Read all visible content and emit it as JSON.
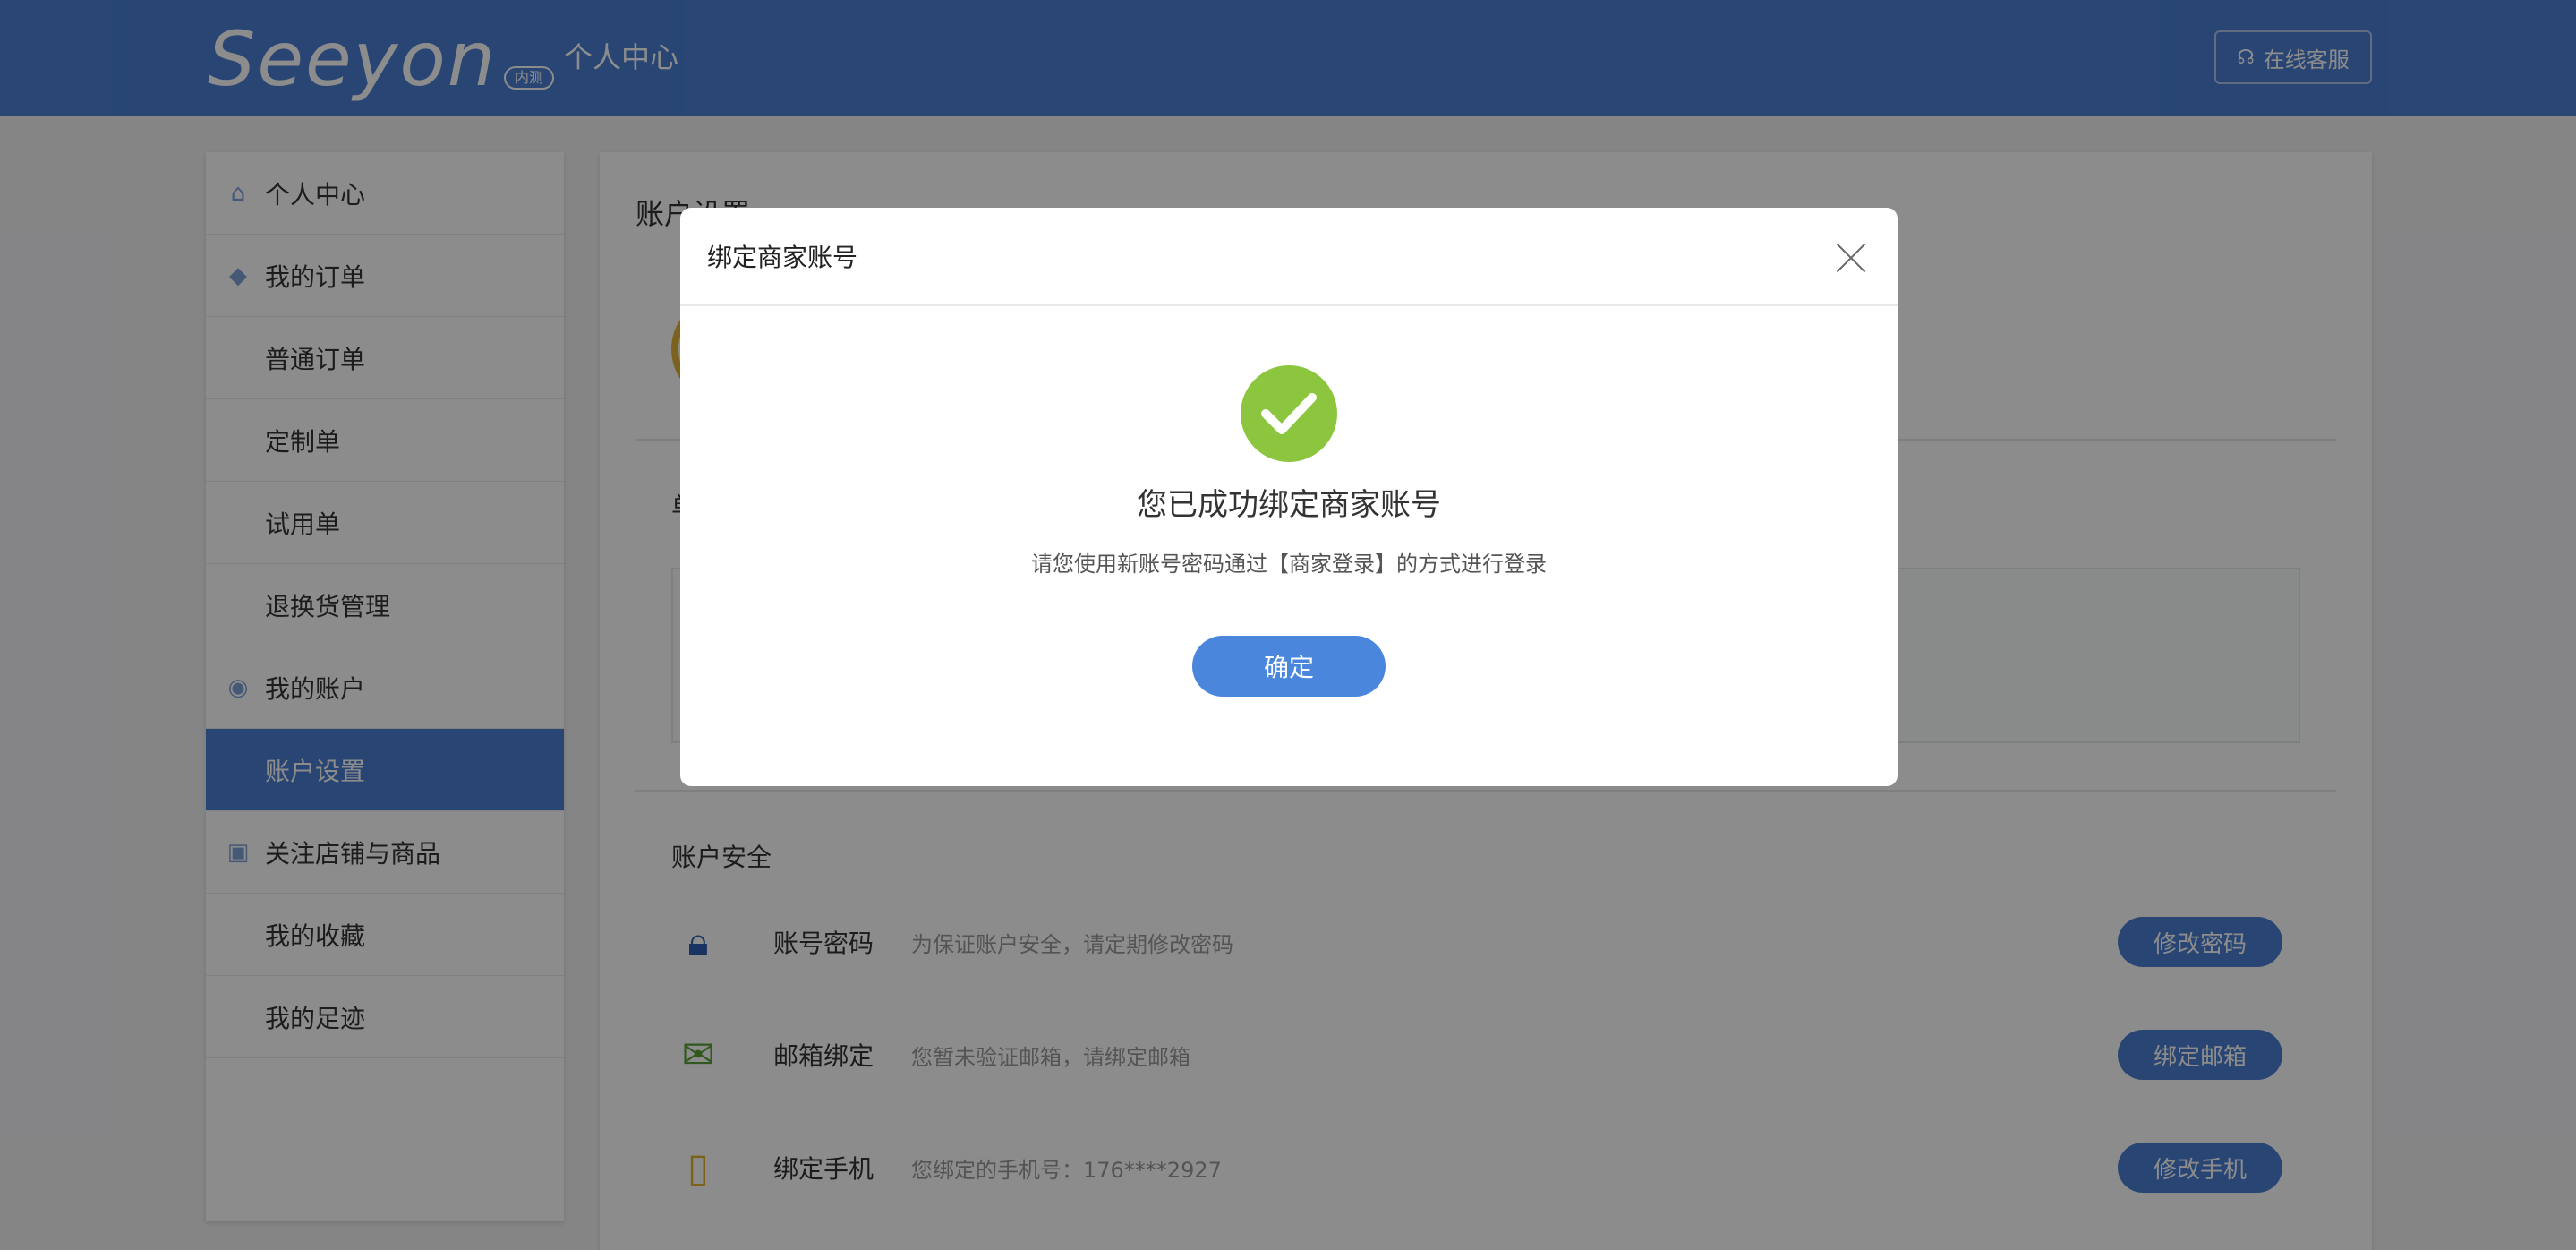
{
  "header": {
    "logo_text": "Seeyon",
    "logo_badge": "内测",
    "title": "个人中心",
    "service_label": "在线客服"
  },
  "sidebar": {
    "items": [
      {
        "label": "个人中心",
        "icon": "home-icon",
        "type": "group"
      },
      {
        "label": "我的订单",
        "icon": "box-icon",
        "type": "group"
      },
      {
        "label": "普通订单",
        "type": "child"
      },
      {
        "label": "定制单",
        "type": "child"
      },
      {
        "label": "试用单",
        "type": "child"
      },
      {
        "label": "退换货管理",
        "type": "child"
      },
      {
        "label": "我的账户",
        "icon": "account-icon",
        "type": "group"
      },
      {
        "label": "账户设置",
        "type": "child",
        "active": true
      },
      {
        "label": "关注店铺与商品",
        "icon": "store-icon",
        "type": "group"
      },
      {
        "label": "我的收藏",
        "type": "child"
      },
      {
        "label": "我的足迹",
        "type": "child"
      }
    ]
  },
  "main": {
    "title": "账户设置",
    "section_label": "单",
    "security": {
      "title": "账户安全",
      "rows": [
        {
          "name": "账号密码",
          "desc": "为保证账户安全，请定期修改密码",
          "button": "修改密码",
          "icon": "lock-icon"
        },
        {
          "name": "邮箱绑定",
          "desc": "您暂未验证邮箱，请绑定邮箱",
          "button": "绑定邮箱",
          "icon": "mail-warning-icon"
        },
        {
          "name": "绑定手机",
          "desc": "您绑定的手机号：176****2927",
          "button": "修改手机",
          "icon": "phone-icon"
        }
      ]
    }
  },
  "modal": {
    "title": "绑定商家账号",
    "message": "您已成功绑定商家账号",
    "sub_message": "请您使用新账号密码通过【商家登录】的方式进行登录",
    "confirm_label": "确定"
  },
  "colors": {
    "brand": "#4a7fd4",
    "success": "#8cc63f",
    "overlay": "rgba(0,0,0,0.45)"
  }
}
